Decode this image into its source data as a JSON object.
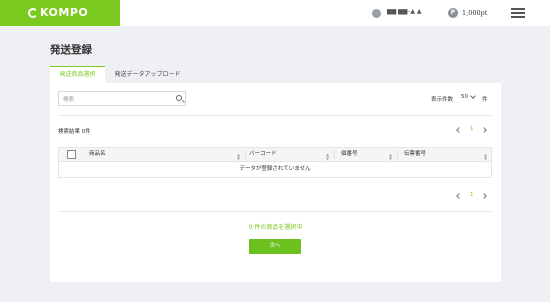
{
  "header": {
    "logo_text": "KOMPO",
    "user_name": "▆▆ ▆▆–▲ ▲",
    "point_icon_label": "P",
    "points": "1,000pt",
    "icons": [
      "user-icon",
      "points-icon",
      "menu-icon"
    ]
  },
  "page": {
    "title": "発送登録"
  },
  "tabs": [
    {
      "label": "発送商品選択",
      "active": true
    },
    {
      "label": "発送データアップロード",
      "active": false
    }
  ],
  "search": {
    "placeholder": "検索"
  },
  "display": {
    "label": "表示件数",
    "value": "50",
    "unit": "件"
  },
  "results": {
    "label": "検索結果 0件"
  },
  "pagination": {
    "current": "1"
  },
  "table": {
    "columns": [
      "商品名",
      "バーコード",
      "個番号",
      "伝票番号"
    ],
    "empty_message": "データが登録されていません"
  },
  "selection": {
    "message": "0 件の商品を選択中"
  },
  "actions": {
    "next_label": "次へ"
  },
  "colors": {
    "accent": "#7ac91e",
    "button": "#6cc11e",
    "background": "#eef0f4"
  }
}
